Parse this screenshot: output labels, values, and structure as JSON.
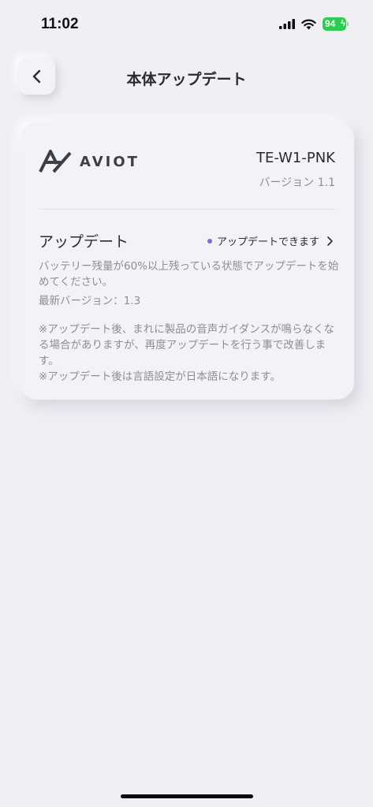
{
  "status_bar": {
    "time": "11:02",
    "battery": "94"
  },
  "header": {
    "title": "本体アップデート"
  },
  "device": {
    "brand": "AVIOT",
    "model": "TE-W1-PNK",
    "version": "バージョン 1.1"
  },
  "update": {
    "title": "アップデート",
    "status": "アップデートできます",
    "description": "バッテリー残量が60%以上残っている状態でアップデートを始めてください。",
    "latest_version": "最新バージョン：1.3",
    "notes": [
      "※アップデート後、まれに製品の音声ガイダンスが鳴らなくなる場合がありますが、再度アップデートを行う事で改善します。",
      "※アップデート後は言語設定が日本語になります。"
    ]
  },
  "colors": {
    "background": "#f0eff4",
    "card": "#f3f2f7",
    "status_dot": "#7d6fc4",
    "battery": "#2ecc51",
    "muted_text": "#8e8d94"
  },
  "icons": {
    "back": "chevron-left-icon",
    "status_arrow": "chevron-right-icon",
    "signal": "cellular-signal-icon",
    "wifi": "wifi-icon",
    "battery": "battery-icon"
  }
}
